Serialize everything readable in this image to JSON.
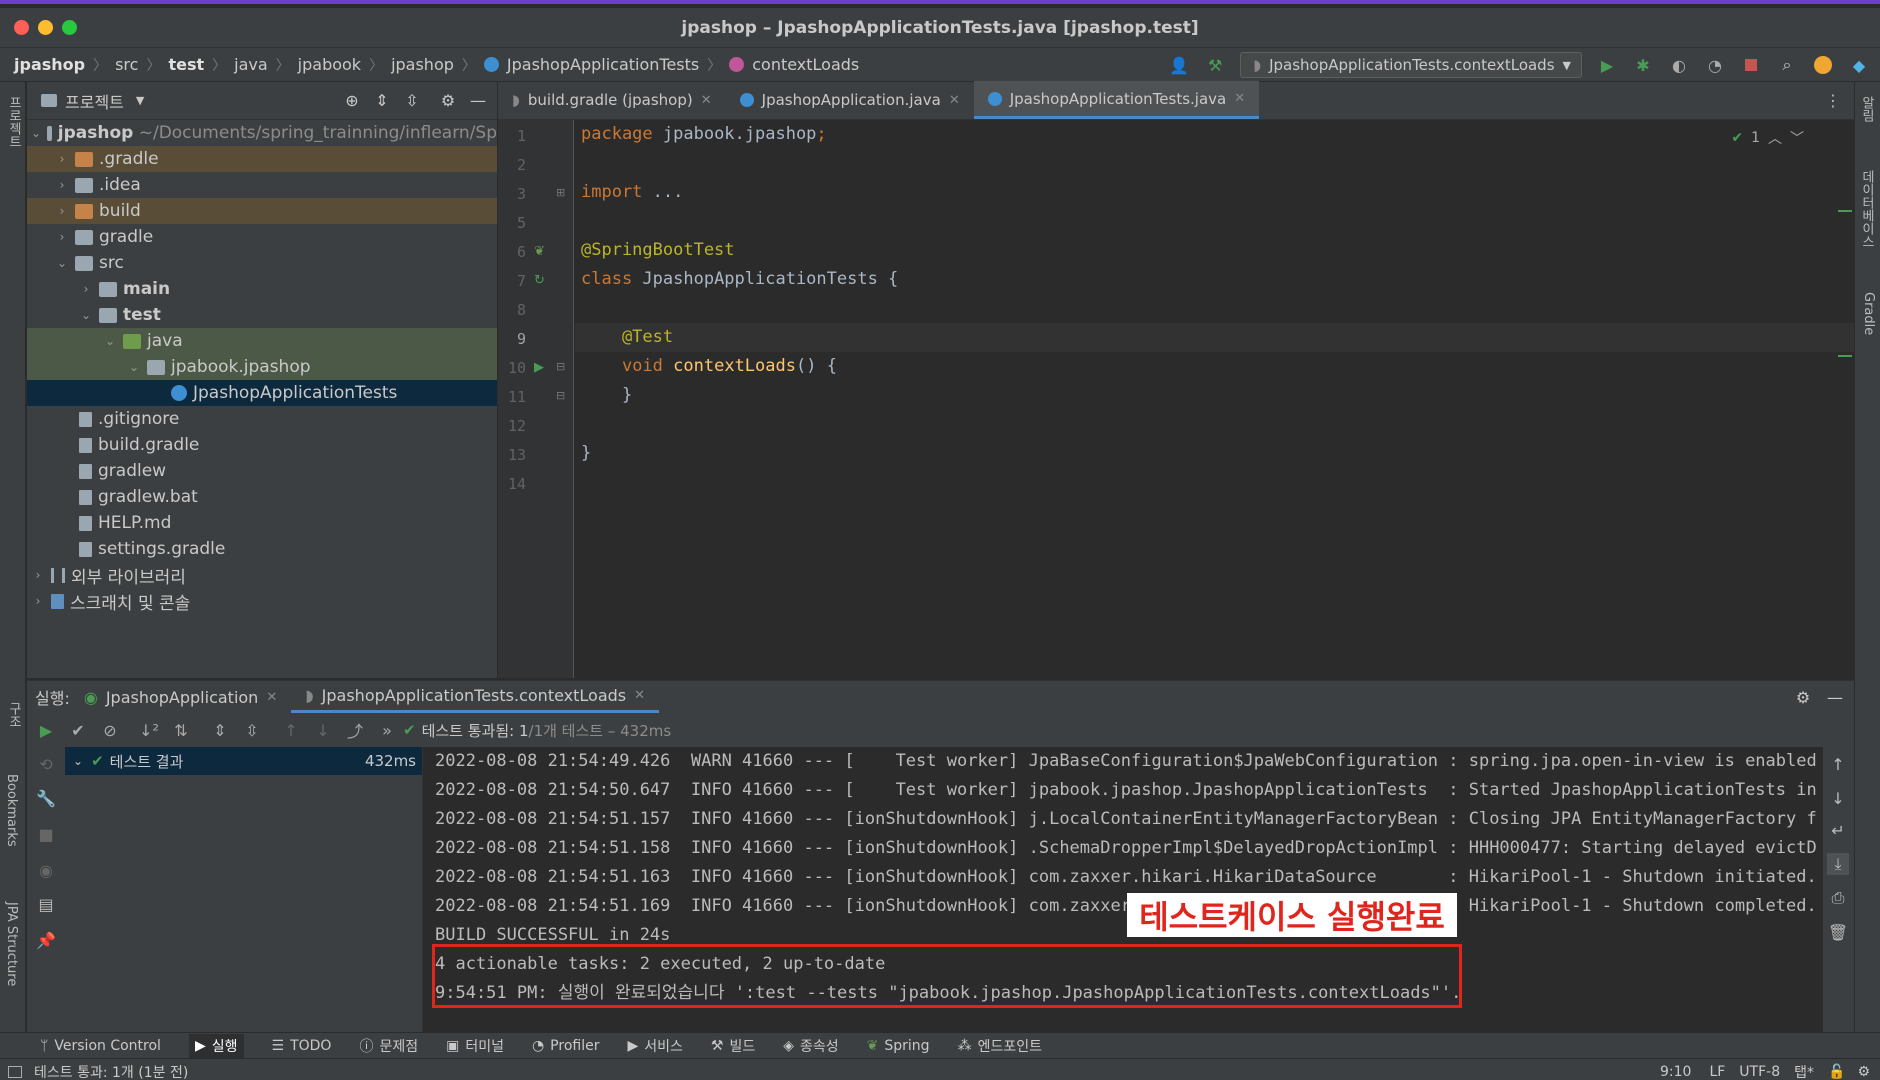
{
  "window": {
    "title": "jpashop – JpashopApplicationTests.java [jpashop.test]"
  },
  "breadcrumb": [
    "jpashop",
    "src",
    "test",
    "java",
    "jpabook",
    "jpashop",
    "JpashopApplicationTests",
    "contextLoads"
  ],
  "run_config": "JpashopApplicationTests.contextLoads",
  "project_panel": {
    "title": "프로젝트"
  },
  "tree": [
    {
      "label": "jpashop",
      "path": "~/Documents/spring_trainning/inflearn/Sp"
    },
    {
      "label": ".gradle"
    },
    {
      "label": ".idea"
    },
    {
      "label": "build"
    },
    {
      "label": "gradle"
    },
    {
      "label": "src"
    },
    {
      "label": "main"
    },
    {
      "label": "test"
    },
    {
      "label": "java"
    },
    {
      "label": "jpabook.jpashop"
    },
    {
      "label": "JpashopApplicationTests"
    },
    {
      "label": ".gitignore"
    },
    {
      "label": "build.gradle"
    },
    {
      "label": "gradlew"
    },
    {
      "label": "gradlew.bat"
    },
    {
      "label": "HELP.md"
    },
    {
      "label": "settings.gradle"
    },
    {
      "label": "외부 라이브러리"
    },
    {
      "label": "스크래치 및 콘솔"
    }
  ],
  "editor_tabs": [
    "build.gradle (jpashop)",
    "JpashopApplication.java",
    "JpashopApplicationTests.java"
  ],
  "code_lines": [
    {
      "n": "1",
      "t": "package jpabook.jpashop;"
    },
    {
      "n": "2",
      "t": ""
    },
    {
      "n": "3",
      "t": "import ..."
    },
    {
      "n": "5",
      "t": ""
    },
    {
      "n": "6",
      "t": "@SpringBootTest"
    },
    {
      "n": "7",
      "t": "class JpashopApplicationTests {"
    },
    {
      "n": "8",
      "t": ""
    },
    {
      "n": "9",
      "t": "    @Test"
    },
    {
      "n": "10",
      "t": "    void contextLoads() {"
    },
    {
      "n": "11",
      "t": "    }"
    },
    {
      "n": "12",
      "t": ""
    },
    {
      "n": "13",
      "t": "}"
    },
    {
      "n": "14",
      "t": ""
    }
  ],
  "inspection_count": "1",
  "run_panel": {
    "label": "실행:",
    "tabs": [
      "JpashopApplication",
      "JpashopApplicationTests.contextLoads"
    ],
    "test_status": "테스트 통과됨: 1",
    "test_status_detail": " /1개 테스트 – 432ms",
    "test_root": "테스트 결과",
    "test_time": "432ms"
  },
  "console_lines": [
    "2022-08-08 21:54:49.426  WARN 41660 --- [    Test worker] JpaBaseConfiguration$JpaWebConfiguration : spring.jpa.open-in-view is enabled",
    "2022-08-08 21:54:50.647  INFO 41660 --- [    Test worker] jpabook.jpashop.JpashopApplicationTests  : Started JpashopApplicationTests in",
    "2022-08-08 21:54:51.157  INFO 41660 --- [ionShutdownHook] j.LocalContainerEntityManagerFactoryBean : Closing JPA EntityManagerFactory f",
    "2022-08-08 21:54:51.158  INFO 41660 --- [ionShutdownHook] .SchemaDropperImpl$DelayedDropActionImpl : HHH000477: Starting delayed evictD",
    "2022-08-08 21:54:51.163  INFO 41660 --- [ionShutdownHook] com.zaxxer.hikari.HikariDataSource       : HikariPool-1 - Shutdown initiated.",
    "2022-08-08 21:54:51.169  INFO 41660 --- [ionShutdownHook] com.zaxxer.hikari.HikariDataSource       : HikariPool-1 - Shutdown completed.",
    "BUILD SUCCESSFUL in 24s",
    "4 actionable tasks: 2 executed, 2 up-to-date",
    "9:54:51 PM: 실행이 완료되었습니다 ':test --tests \"jpabook.jpashop.JpashopApplicationTests.contextLoads\"'."
  ],
  "annotation": "테스트케이스 실행완료",
  "bottom_tools": [
    "Version Control",
    "실행",
    "TODO",
    "문제점",
    "터미널",
    "Profiler",
    "서비스",
    "빌드",
    "종속성",
    "Spring",
    "엔드포인트"
  ],
  "left_strip": [
    "프로젝트",
    "구조",
    "Bookmarks",
    "JPA Structure"
  ],
  "right_strip": [
    "알림",
    "데이터베이스",
    "Gradle"
  ],
  "status": {
    "message": "테스트 통과: 1개 (1분 전)",
    "position": "9:10",
    "line_sep": "LF",
    "encoding": "UTF-8",
    "indent": "탭*"
  },
  "colors": {
    "accent": "#4a88c7",
    "success": "#499c54",
    "annotation_red": "#e0261c"
  }
}
